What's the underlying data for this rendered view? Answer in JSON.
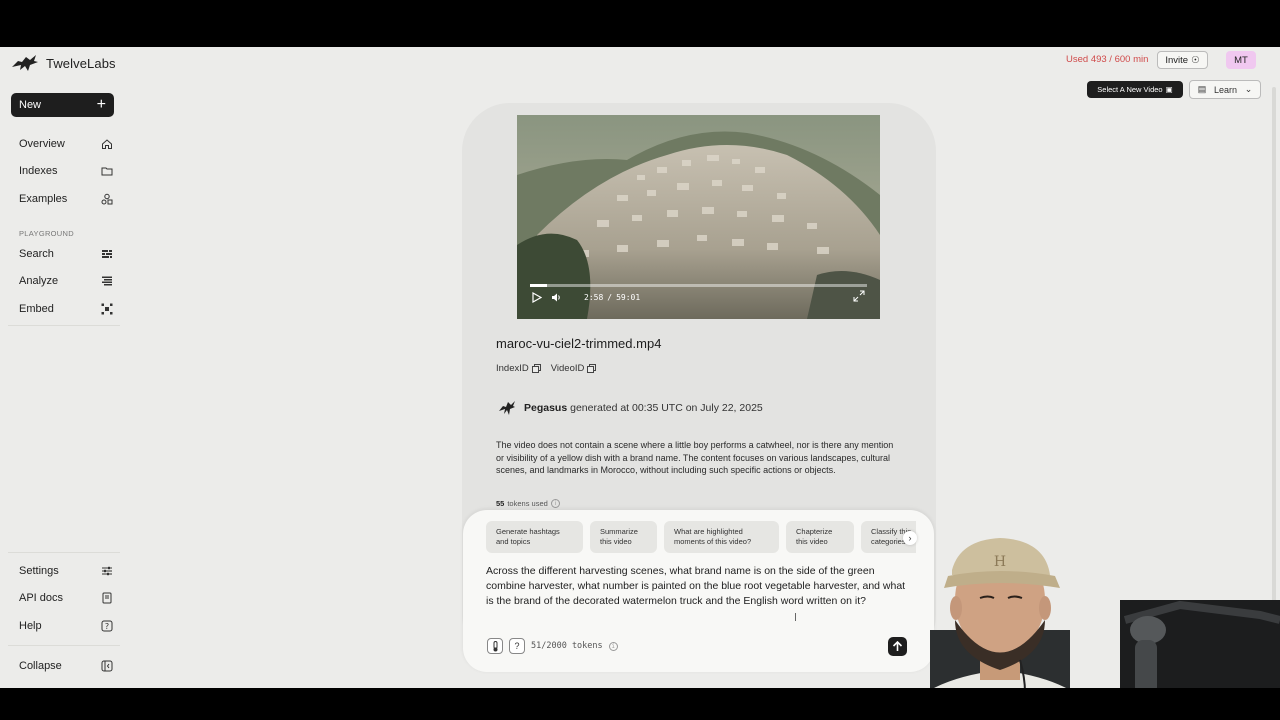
{
  "brand": {
    "name": "TwelveLabs"
  },
  "sidebar": {
    "new_label": "New",
    "nav": [
      {
        "label": "Overview",
        "icon": "home-icon"
      },
      {
        "label": "Indexes",
        "icon": "folder-icon"
      },
      {
        "label": "Examples",
        "icon": "shapes-icon"
      }
    ],
    "section_label": "PLAYGROUND",
    "playground": [
      {
        "label": "Search",
        "icon": "search-sliders-icon"
      },
      {
        "label": "Analyze",
        "icon": "analyze-lines-icon"
      },
      {
        "label": "Embed",
        "icon": "embed-nodes-icon"
      }
    ],
    "bottom": [
      {
        "label": "Settings",
        "icon": "sliders-icon"
      },
      {
        "label": "API docs",
        "icon": "book-icon"
      },
      {
        "label": "Help",
        "icon": "help-icon"
      }
    ],
    "collapse_label": "Collapse"
  },
  "header": {
    "usage": "Used 493 / 600 min",
    "invite_label": "Invite",
    "avatar_initials": "MT",
    "select_video_label": "Select A New Video",
    "learn_label": "Learn"
  },
  "player": {
    "current_time": "2:58",
    "separator": "/",
    "duration": "59:01",
    "progress_fraction": 0.05
  },
  "video": {
    "filename": "maroc-vu-ciel2-trimmed.mp4",
    "index_id_label": "IndexID",
    "video_id_label": "VideoID"
  },
  "generation": {
    "model": "Pegasus",
    "generated_text": "generated at 00:35 UTC on July 22, 2025",
    "response": "The video does not contain a scene where a little boy performs a catwheel, nor is there any mention or visibility of a yellow dish with a brand name. The content focuses on various landscapes, cultural scenes, and landmarks in Morocco, without including such specific actions or objects.",
    "tokens_count": "55",
    "tokens_label": "tokens used"
  },
  "chips": [
    "Generate hashtags and topics",
    "Summarize this video",
    "What are highlighted moments of this video?",
    "Chapterize this video",
    "Classify this categories"
  ],
  "prompt": {
    "text": "Across the different harvesting scenes, what brand name is on the side of the green combine harvester, what number is painted on the blue root vegetable harvester, and what is the brand of the decorated watermelon truck and the English word written on it?",
    "token_counter": "51/2000 tokens",
    "help_label": "?"
  },
  "colors": {
    "accent_dark": "#1e1e1e",
    "usage_red": "#d04a4a",
    "avatar_bg": "#f0c8f0"
  }
}
